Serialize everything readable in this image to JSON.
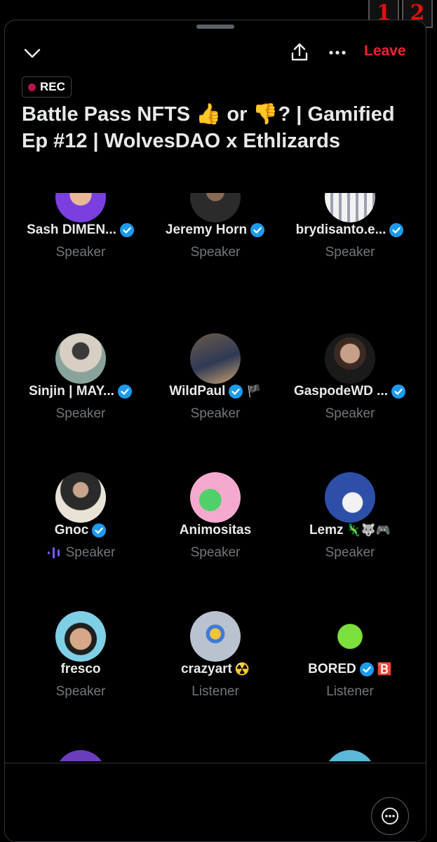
{
  "window": {
    "corner_badges": [
      "1",
      "2"
    ]
  },
  "header": {
    "leave_label": "Leave",
    "rec_label": "REC",
    "title": "Battle Pass NFTS 👍 or 👎? | Gamified Ep #12 | WolvesDAO x Ethlizards"
  },
  "participants": [
    {
      "name": "Sash DIMEN...",
      "role": "Speaker",
      "verified": true,
      "extra": ""
    },
    {
      "name": "Jeremy Horn",
      "role": "Speaker",
      "verified": true,
      "extra": ""
    },
    {
      "name": "brydisanto.e...",
      "role": "Speaker",
      "verified": true,
      "extra": ""
    },
    {
      "name": "Sinjin | MAY...",
      "role": "Speaker",
      "verified": true,
      "extra": ""
    },
    {
      "name": "WildPaul",
      "role": "Speaker",
      "verified": true,
      "extra": "🏴"
    },
    {
      "name": "GaspodeWD ...",
      "role": "Speaker",
      "verified": true,
      "extra": ""
    },
    {
      "name": "Gnoc",
      "role": "Speaker",
      "verified": true,
      "extra": "",
      "speaking": true
    },
    {
      "name": "Animositas",
      "role": "Speaker",
      "verified": false,
      "extra": ""
    },
    {
      "name": "Lemz",
      "role": "Speaker",
      "verified": false,
      "extra": "🦎🐺🎮"
    },
    {
      "name": "fresco",
      "role": "Speaker",
      "verified": false,
      "extra": ""
    },
    {
      "name": "crazyart",
      "role": "Listener",
      "verified": false,
      "extra": "☢️"
    },
    {
      "name": "BORED",
      "role": "Listener",
      "verified": true,
      "extra": "🅱️"
    }
  ],
  "icons": {
    "collapse": "chevron-down-icon",
    "share": "share-icon",
    "more": "more-horizontal-icon",
    "bottom_more": "chat-bubble-more-icon",
    "verified": "verified-badge-icon",
    "speaking": "audio-wave-icon"
  },
  "colors": {
    "leave": "#f4212e",
    "rec_dot": "#b3144f",
    "verified": "#1d9bf0",
    "secondary_text": "#71767b",
    "speaking": "#7856ff"
  }
}
